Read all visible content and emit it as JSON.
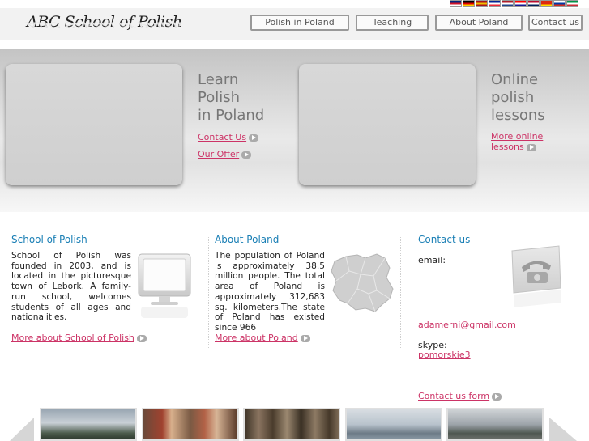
{
  "header": {
    "logo": "ABC School of Polish",
    "flags": [
      {
        "name": "uk-flag-icon",
        "colors": [
          "#00247d",
          "#cf142b",
          "#ffffff"
        ]
      },
      {
        "name": "germany-flag-icon",
        "colors": [
          "#000000",
          "#dd0000",
          "#ffce00"
        ]
      },
      {
        "name": "spain-flag-icon",
        "colors": [
          "#aa151b",
          "#f1bf00",
          "#aa151b"
        ]
      },
      {
        "name": "france-flag-icon",
        "colors": [
          "#002395",
          "#ffffff",
          "#ed2939"
        ]
      },
      {
        "name": "netherlands-flag-icon",
        "colors": [
          "#ae1c28",
          "#ffffff",
          "#21468b"
        ]
      },
      {
        "name": "croatia-flag-icon",
        "colors": [
          "#ff0000",
          "#ffffff",
          "#171796"
        ]
      },
      {
        "name": "norway-flag-icon",
        "colors": [
          "#ba0c2f",
          "#ffffff",
          "#00205b"
        ]
      },
      {
        "name": "china-flag-icon",
        "colors": [
          "#de2910",
          "#de2910",
          "#ffde00"
        ]
      },
      {
        "name": "russia-flag-icon",
        "colors": [
          "#ffffff",
          "#0039a6",
          "#d52b1e"
        ]
      },
      {
        "name": "italy-flag-icon",
        "colors": [
          "#009246",
          "#ffffff",
          "#ce2b37"
        ]
      }
    ],
    "nav": {
      "polish_in_poland": "Polish in Poland",
      "teaching": "Teaching",
      "about_poland": "About Poland",
      "contact_us": "Contact us"
    }
  },
  "band": {
    "left": {
      "title_line1": "Learn",
      "title_line2": "Polish",
      "title_line3": "in Poland",
      "link1": "Contact Us",
      "link2": "Our Offer"
    },
    "right": {
      "title_line1": "Online",
      "title_line2": "polish",
      "title_line3": "lessons",
      "link1_line1": "More online",
      "link1_line2": "lessons"
    }
  },
  "columns": {
    "school": {
      "title": "School of Polish",
      "text": "School of Polish was founded in 2003, and is located in the picturesque town of Lebork. A family-run school, welcomes students of all ages and nationalities.",
      "link": "More about School of Polish"
    },
    "poland": {
      "title": "About Poland",
      "text": "The population of Poland is approximately 38.5 million people. The total area of Poland is approximately 312,683 sq. kilometers.The state of Poland has existed since 966",
      "link": "More about Poland"
    },
    "contact": {
      "title": "Contact us",
      "email_label": "email:",
      "email": "adamerni@gmail.com",
      "skype_label": "skype:",
      "skype": "pomorskie3",
      "form_link": "Contact us form"
    }
  },
  "colors": {
    "accent_link": "#cc3366",
    "title_blue": "#1a7fb5",
    "band_title": "#777777"
  }
}
